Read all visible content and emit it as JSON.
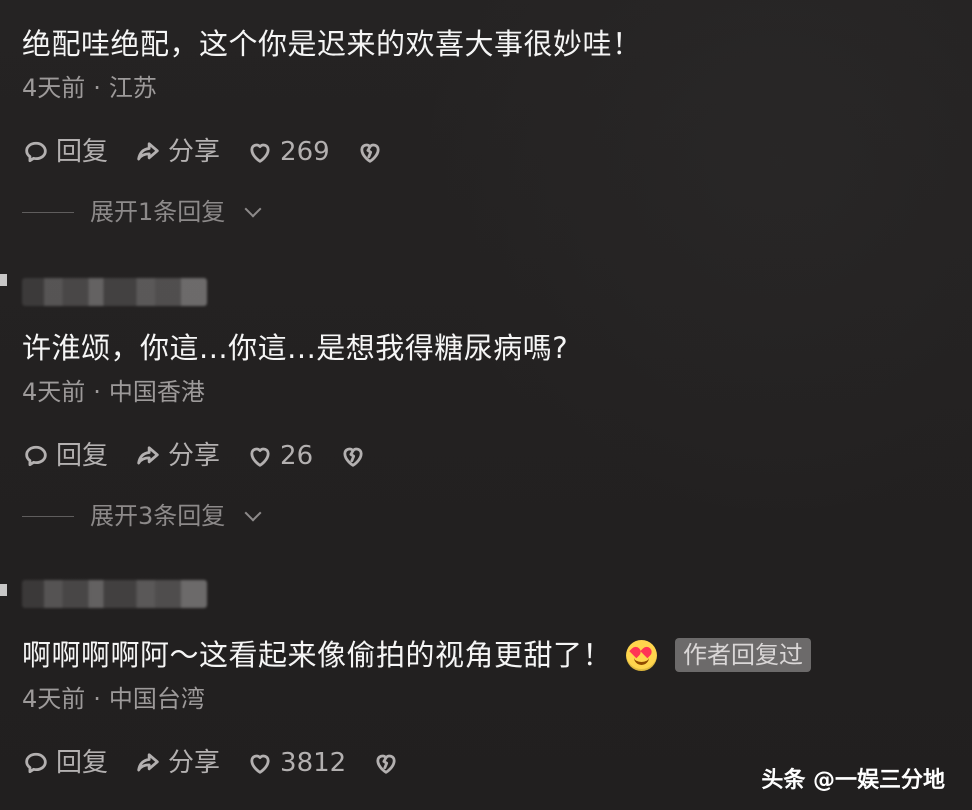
{
  "comments": [
    {
      "text": "绝配哇绝配，这个你是迟来的欢喜大事很妙哇！",
      "time": "4天前",
      "location": "江苏",
      "reply_label": "回复",
      "share_label": "分享",
      "likes": "269",
      "expand_label": "展开1条回复"
    },
    {
      "text": "许淮颂，你這...你這...是想我得糖尿病嗎?",
      "time": "4天前",
      "location": "中国香港",
      "reply_label": "回复",
      "share_label": "分享",
      "likes": "26",
      "expand_label": "展开3条回复"
    },
    {
      "text": "啊啊啊啊阿～这看起来像偷拍的视角更甜了！",
      "time": "4天前",
      "location": "中国台湾",
      "reply_label": "回复",
      "share_label": "分享",
      "likes": "3812",
      "badge": "作者回复过"
    }
  ],
  "watermark": "头条 @一娱三分地",
  "icons": {
    "reply": "reply-icon",
    "share": "share-icon",
    "like": "heart-icon",
    "dislike": "broken-heart-icon",
    "emoji": "heart-eyes-emoji-icon",
    "expand": "chevron-down-icon"
  },
  "colors": {
    "background": "#222020",
    "text": "#f5f5f5",
    "muted": "#9d9a9a",
    "badge": "#6c6a6a"
  }
}
